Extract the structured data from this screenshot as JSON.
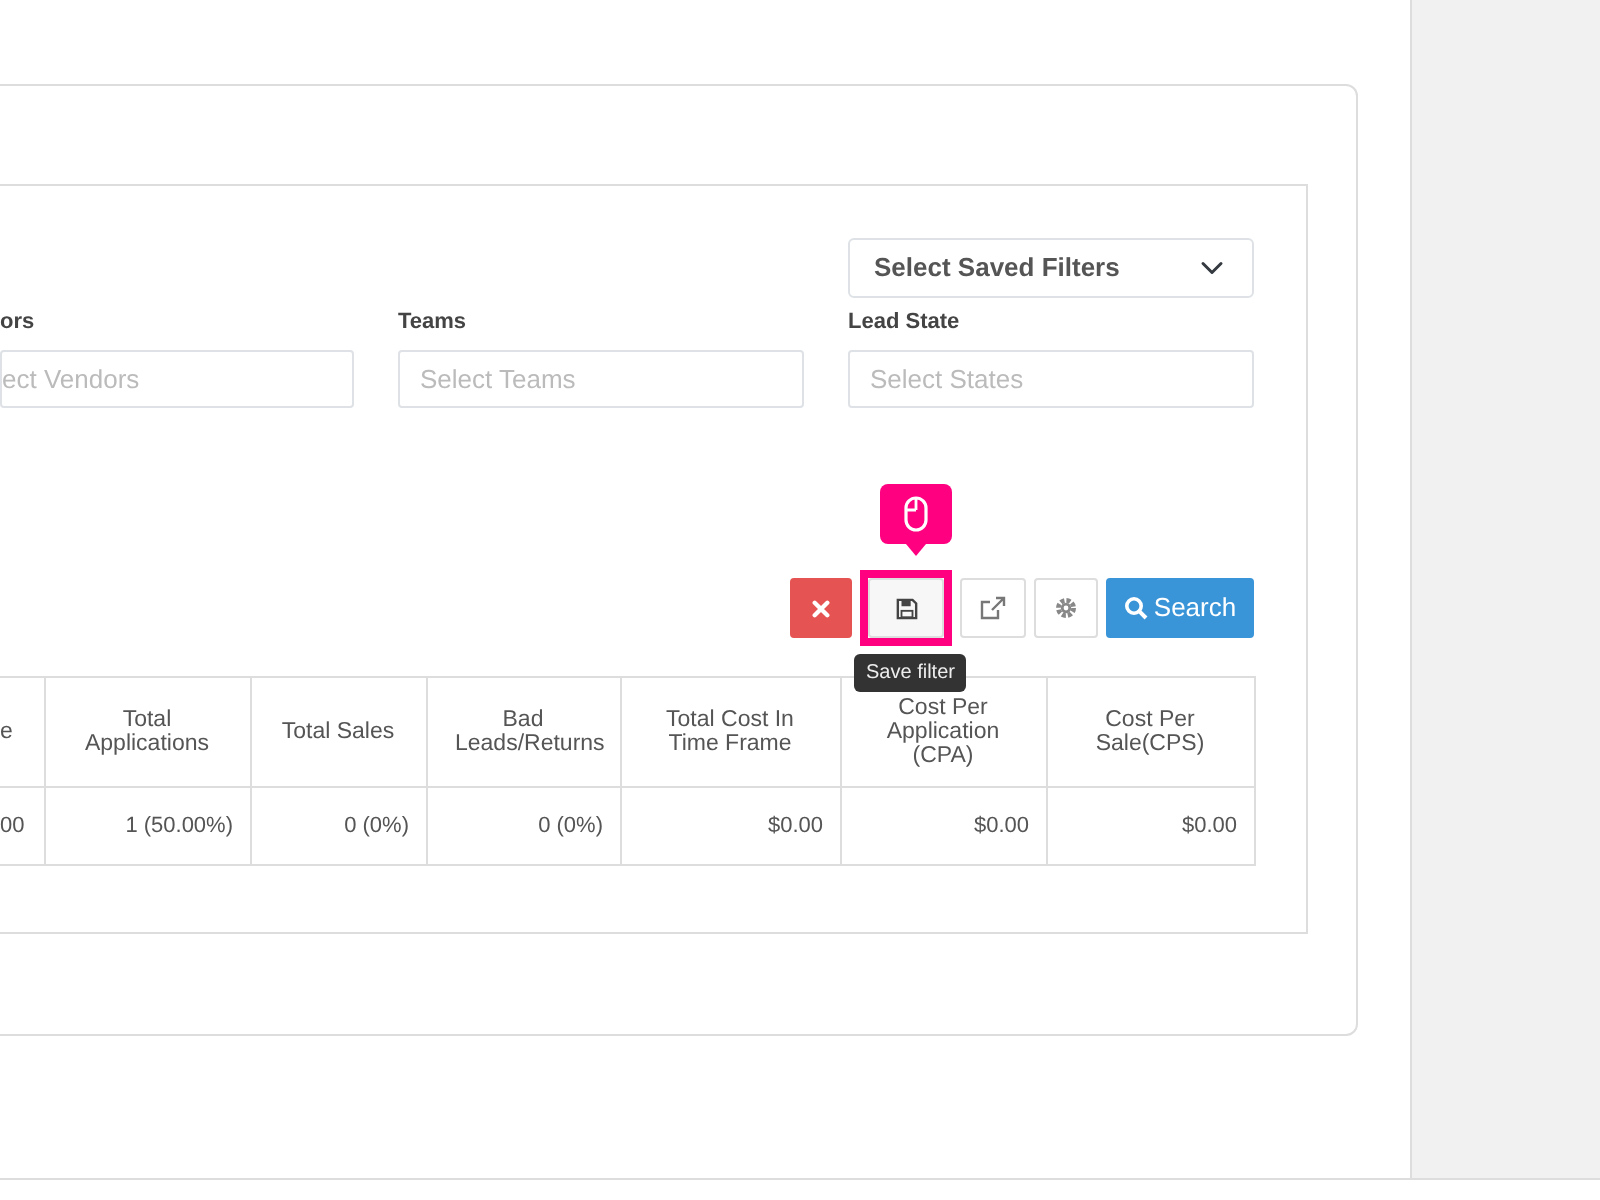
{
  "saved_filters": {
    "value": "Select Saved Filters"
  },
  "filters": [
    {
      "label": "ors",
      "placeholder": "ect Vendors"
    },
    {
      "label": "Teams",
      "placeholder": "Select Teams"
    },
    {
      "label": "Lead State",
      "placeholder": "Select States"
    }
  ],
  "toolbar": [
    {
      "kind": "clear",
      "highlighted": false
    },
    {
      "kind": "save",
      "highlighted": true,
      "tooltip": "Save filter"
    },
    {
      "kind": "export",
      "highlighted": false
    },
    {
      "kind": "settings",
      "highlighted": false
    },
    {
      "kind": "search",
      "label": "Search",
      "highlighted": false
    }
  ],
  "table": {
    "columns": [
      "e",
      "Total Applications",
      "Total Sales",
      "Bad Leads/Returns",
      "Total Cost In Time Frame",
      "Cost Per Application (CPA)",
      "Cost Per Sale(CPS)"
    ],
    "rows": [
      [
        "00",
        "1 (50.00%)",
        "0 (0%)",
        "0 (0%)",
        "$0.00",
        "$0.00",
        "$0.00"
      ]
    ]
  }
}
